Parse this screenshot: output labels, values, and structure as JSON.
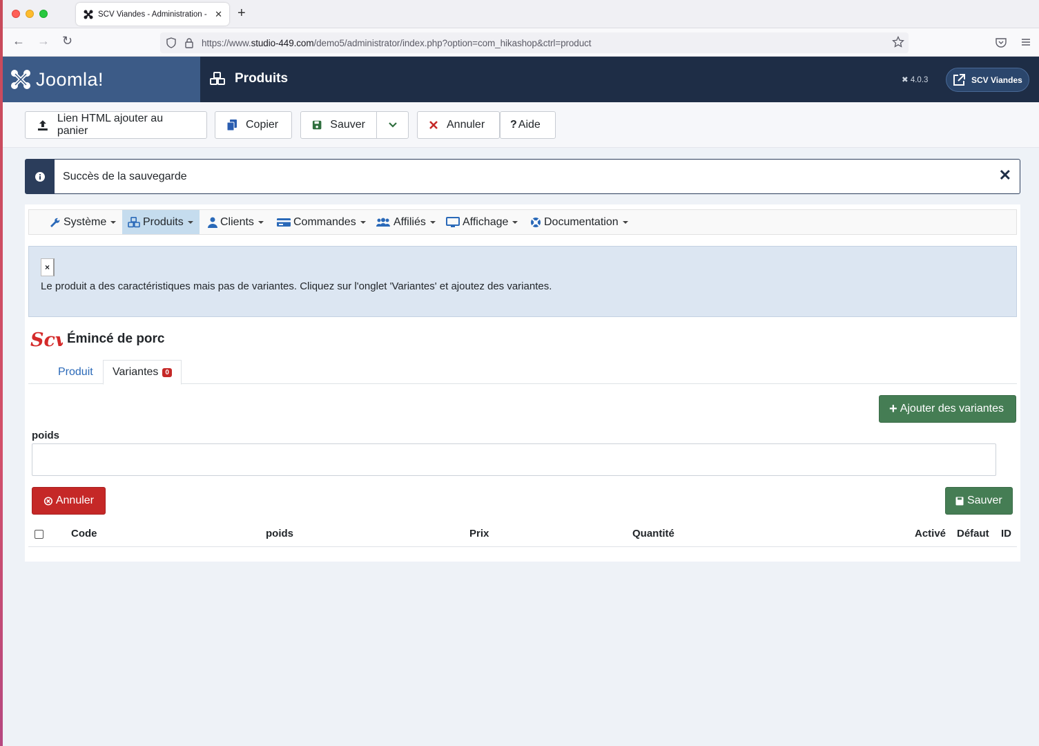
{
  "browser": {
    "tab_title": "SCV Viandes - Administration - ",
    "url_prefix": "https://www.",
    "url_domain": "studio-449.com",
    "url_path": "/demo5/administrator/index.php?option=com_hikashop&ctrl=product"
  },
  "header": {
    "logo_text": "Joomla!",
    "page_title": "Produits",
    "version": "4.0.3",
    "user_label": "SCV Viandes"
  },
  "toolbar": {
    "link_html": "Lien HTML ajouter au panier",
    "copy": "Copier",
    "save": "Sauver",
    "cancel": "Annuler",
    "help": "Aide"
  },
  "message": {
    "text": "Succès de la sauvegarde"
  },
  "menu": {
    "system": "Système",
    "products": "Produits",
    "clients": "Clients",
    "orders": "Commandes",
    "affiliates": "Affiliés",
    "display": "Affichage",
    "documentation": "Documentation"
  },
  "notice": {
    "close": "×",
    "text": "Le produit a des caractéristiques mais pas de variantes. Cliquez sur l'onglet 'Variantes' et ajoutez des variantes."
  },
  "product": {
    "logo_text": "Scv",
    "name": "Émincé de porc"
  },
  "tabs": {
    "product": "Produit",
    "variants": "Variantes",
    "variants_count": "0"
  },
  "variants": {
    "add_button": "Ajouter des variantes",
    "field_label": "poids",
    "field_value": "",
    "cancel": "Annuler",
    "save": "Sauver"
  },
  "table": {
    "columns": [
      "Code",
      "poids",
      "Prix",
      "Quantité",
      "Activé",
      "Défaut",
      "ID"
    ]
  },
  "colors": {
    "joomla_dark": "#1e2d46",
    "joomla_logo_bg": "#3c5b87",
    "success_green": "#457d54",
    "danger_red": "#c52827",
    "link_blue": "#2a69b8"
  }
}
